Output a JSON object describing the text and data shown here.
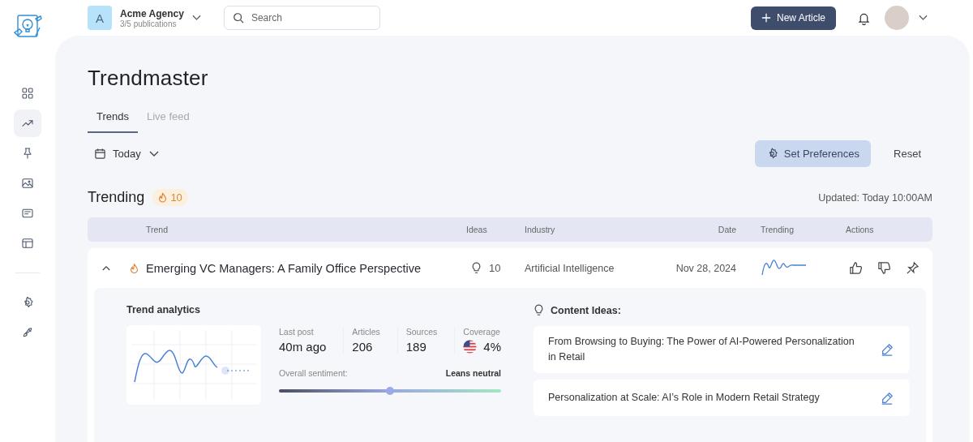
{
  "org": {
    "initial": "A",
    "name": "Acme Agency",
    "subtitle": "3/5 publications"
  },
  "search": {
    "placeholder": "Search"
  },
  "new_article_button": "New Article",
  "sidebar": {
    "items": [
      {
        "selected": false
      },
      {
        "selected": true
      },
      {
        "selected": false
      },
      {
        "selected": false
      },
      {
        "selected": false
      },
      {
        "selected": false
      }
    ],
    "bottom_items": [
      {
        "selected": false
      },
      {
        "selected": false
      }
    ]
  },
  "page_title": "Trendmaster",
  "tabs": [
    {
      "label": "Trends",
      "selected": true
    },
    {
      "label": "Live feed",
      "selected": false
    }
  ],
  "date_filter": "Today",
  "buttons": {
    "preferences": "Set Preferences",
    "reset": "Reset"
  },
  "trending": {
    "title": "Trending",
    "count": "10",
    "updated": "Updated: Today 10:00AM"
  },
  "table": {
    "columns": [
      "Trend",
      "Ideas",
      "Industry",
      "Date",
      "Trending",
      "Actions"
    ],
    "rows": [
      {
        "title": "Emerging VC Managers: A Family Office Perspective",
        "ideas": "10",
        "industry": "Artificial Intelligence",
        "date": "Nov 28, 2024",
        "expanded": true,
        "analytics": {
          "title": "Trend analytics",
          "stats": [
            {
              "kind": "plain",
              "label": "Last post",
              "value": "40m ago"
            },
            {
              "kind": "plain",
              "label": "Articles",
              "value": "206"
            },
            {
              "kind": "plain",
              "label": "Sources",
              "value": "189"
            },
            {
              "kind": "flag",
              "label": "Coverage",
              "value": "4%"
            }
          ],
          "sentiment": {
            "label": "Overall sentiment:",
            "reading": "Leans neutral",
            "level": 0.5
          }
        },
        "content_ideas": {
          "title": "Content Ideas:",
          "items": [
            {
              "text": "From Browsing to Buying: The Power of AI-Powered Personalization in Retail"
            },
            {
              "text": "Personalization at Scale: AI’s Role in Modern Retail Strategy"
            }
          ]
        }
      }
    ]
  }
}
